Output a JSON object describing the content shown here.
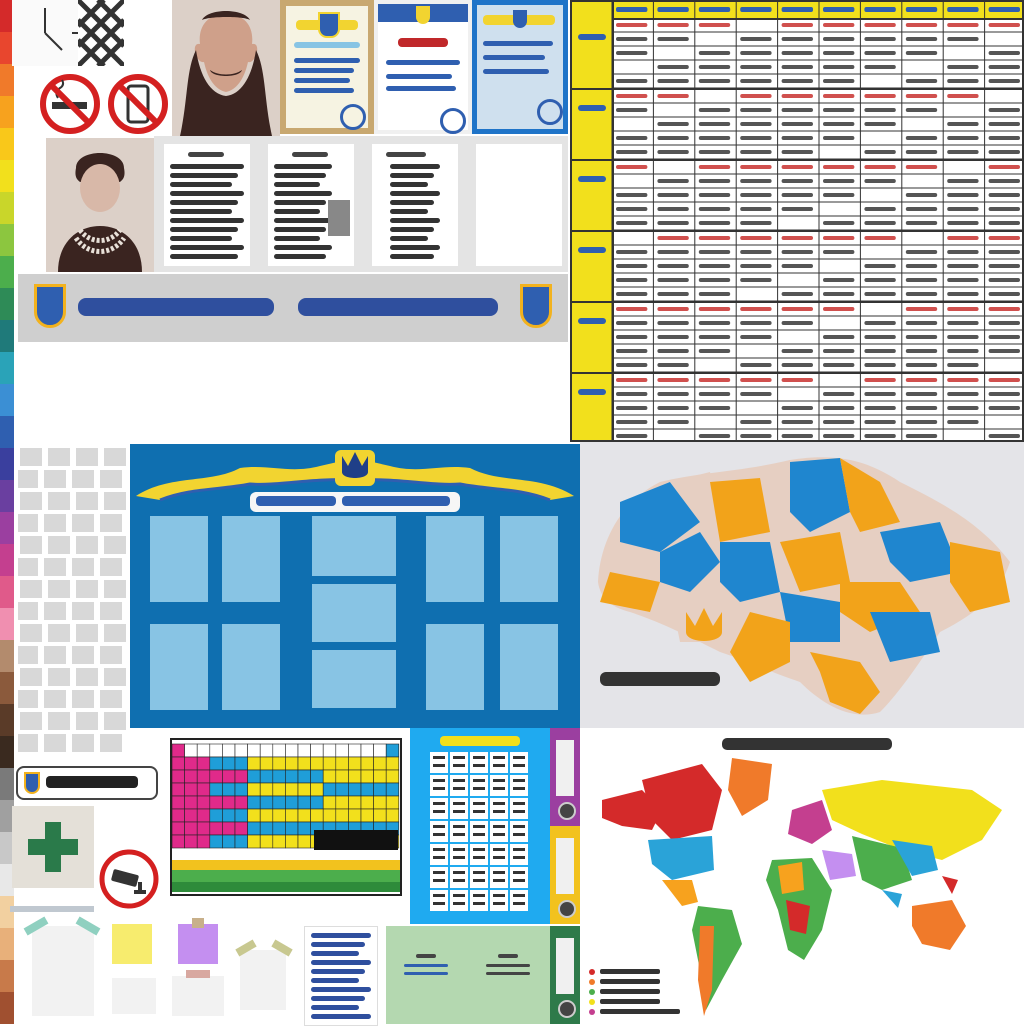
{
  "palette_colors": [
    "#d42a2a",
    "#e8462e",
    "#f07a2a",
    "#f7a21e",
    "#f9c81a",
    "#f2e01c",
    "#c9d62a",
    "#8cc63f",
    "#4cae4c",
    "#2e8b57",
    "#1f7a7a",
    "#2aa3b8",
    "#3b8fd4",
    "#2f5fb0",
    "#3a3f9e",
    "#6a3fa0",
    "#9b3fa0",
    "#c43f8f",
    "#e05a8a",
    "#f08fb0",
    "#b38b6d",
    "#8b5a3c",
    "#5a3b28",
    "#3a2a1f",
    "#7a7a7a",
    "#a0a0a0",
    "#c8c8c8",
    "#e8e8e8",
    "#f2d0a0",
    "#e8b07a",
    "#c87a4a",
    "#a05030"
  ],
  "colors": {
    "ukraine_blue": "#2f5fb0",
    "ukraine_yellow": "#f2e01c",
    "stand_blue": "#0f6fb0",
    "frame_light_blue": "#88c4e4",
    "schedule_red": "#d0504e",
    "schedule_gray": "#555555",
    "map_blue": "#1f86cf",
    "map_orange": "#f2a31a",
    "map_beige": "#e6cfc2",
    "map_bg": "#e4e4e8"
  },
  "icons": [
    "clock-icon",
    "no-smoking-icon",
    "no-phone-icon",
    "first-aid-cross-icon",
    "cctv-camera-icon",
    "coat-of-arms-icon",
    "trident-icon"
  ],
  "world_map_legend_count": 5,
  "periodic_table_color_bands": [
    "#e02a8a",
    "#f2e01c",
    "#1f9ed8",
    "#4cae4c"
  ]
}
